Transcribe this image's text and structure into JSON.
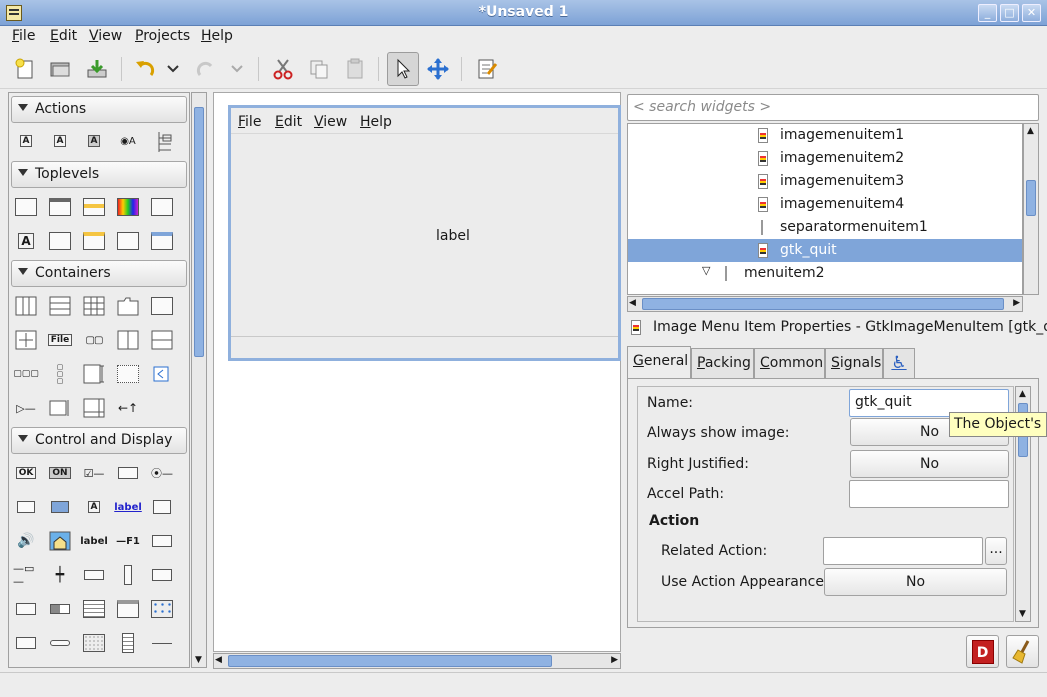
{
  "window": {
    "title": "*Unsaved 1"
  },
  "menubar": [
    "File",
    "Edit",
    "View",
    "Projects",
    "Help"
  ],
  "palette": {
    "groups": [
      "Actions",
      "Toplevels",
      "Containers",
      "Control and Display"
    ],
    "icon_text": {
      "file": "File",
      "ok": "OK",
      "on": "ON",
      "label_link": "label",
      "label": "label",
      "f1": "—F1",
      "a": "A"
    }
  },
  "design": {
    "menu": [
      "File",
      "Edit",
      "View",
      "Help"
    ],
    "label": "label"
  },
  "search": {
    "placeholder": "< search widgets >"
  },
  "tree": {
    "items": [
      {
        "label": "imagemenuitem1",
        "icon": "image-menu-item-icon"
      },
      {
        "label": "imagemenuitem2",
        "icon": "image-menu-item-icon"
      },
      {
        "label": "imagemenuitem3",
        "icon": "image-menu-item-icon"
      },
      {
        "label": "imagemenuitem4",
        "icon": "image-menu-item-icon"
      },
      {
        "label": "separatormenuitem1",
        "icon": "separator-menu-item-icon"
      },
      {
        "label": "gtk_quit",
        "icon": "image-menu-item-icon",
        "selected": true
      },
      {
        "label": "menuitem2",
        "icon": "menu-item-icon",
        "expanded": true
      }
    ]
  },
  "properties": {
    "title": "Image Menu Item Properties - GtkImageMenuItem [gtk_q...",
    "tabs": [
      "General",
      "Packing",
      "Common",
      "Signals"
    ],
    "name_label": "Name:",
    "name_value": "gtk_quit",
    "always_show_label": "Always show image:",
    "always_show_value": "No",
    "right_justified_label": "Right Justified:",
    "right_justified_value": "No",
    "accel_path_label": "Accel Path:",
    "action_header": "Action",
    "related_action_label": "Related Action:",
    "related_action_browse": "...",
    "use_action_label": "Use Action Appearance:",
    "use_action_value": "No"
  },
  "tooltip": "The Object's n"
}
